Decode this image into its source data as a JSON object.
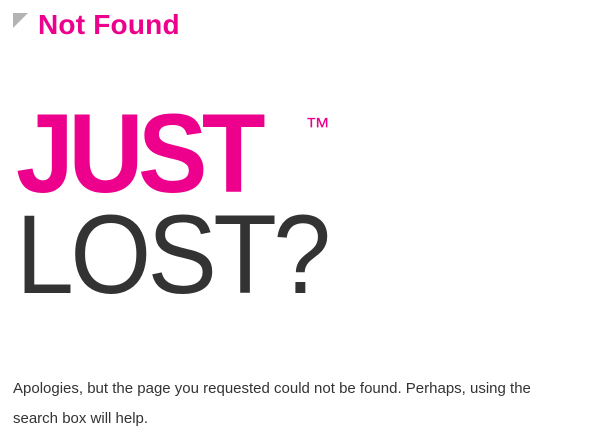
{
  "header": {
    "title": "Not Found",
    "corner_icon": "corner-triangle-icon"
  },
  "hero": {
    "line1": "JUST",
    "trademark": "™",
    "line2": "LOST?"
  },
  "content": {
    "message": "Apologies, but the page you requested could not be found. Perhaps, using the search box will help."
  },
  "colors": {
    "accent": "#ec008c",
    "text": "#333333",
    "corner": "#b3b3b3",
    "background": "#ffffff"
  }
}
